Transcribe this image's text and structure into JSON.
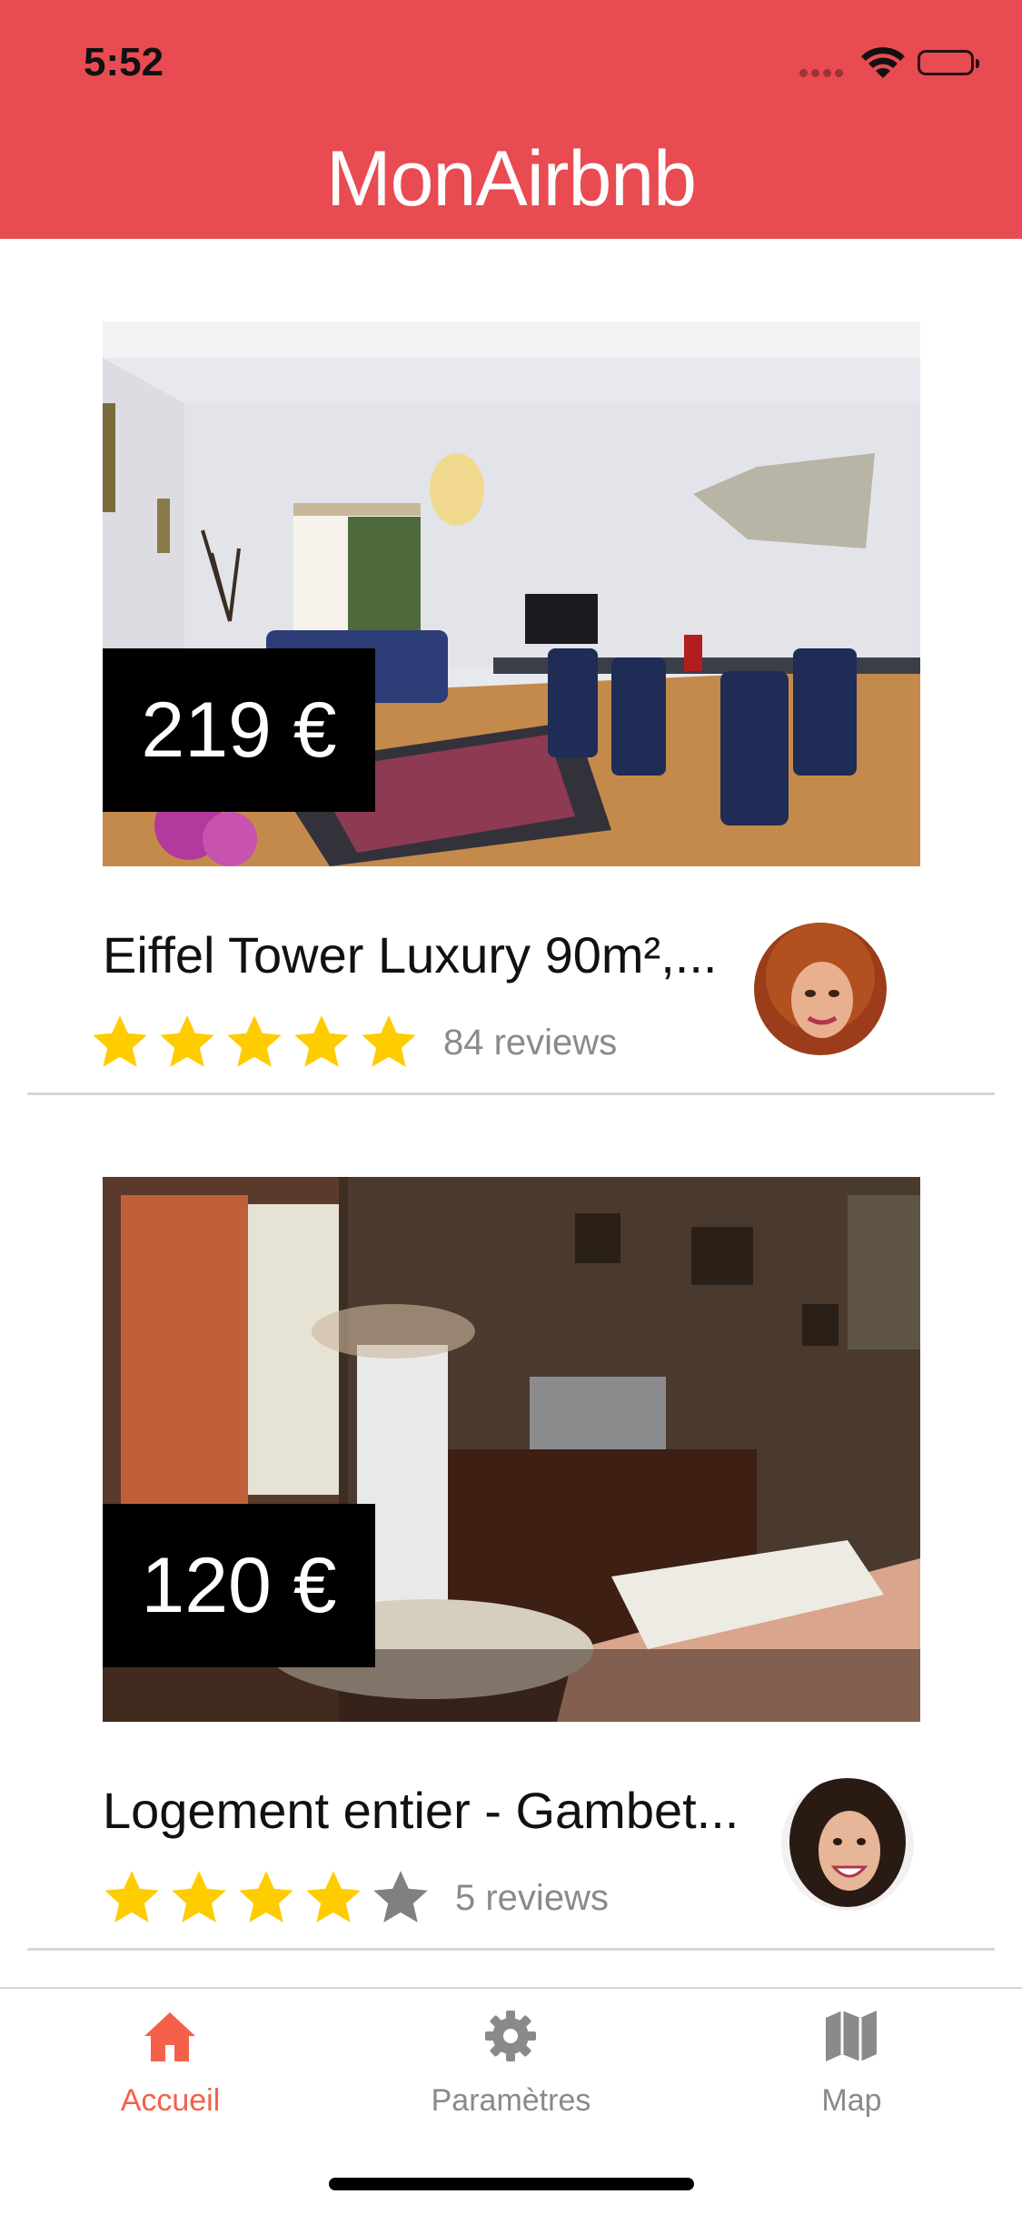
{
  "status_bar": {
    "time": "5:52"
  },
  "header": {
    "title": "MonAirbnb",
    "color": "#E94B52"
  },
  "listings": [
    {
      "price": "219 €",
      "title": "Eiffel Tower Luxury 90m²,...",
      "rating": 5,
      "max_rating": 5,
      "reviews": "84 reviews"
    },
    {
      "price": "120 €",
      "title": "Logement entier - Gambet...",
      "rating": 4,
      "max_rating": 5,
      "reviews": "5 reviews"
    }
  ],
  "tabbar": {
    "active_color": "#F4614A",
    "inactive_color": "#8a8a8a",
    "items": [
      {
        "label": "Accueil",
        "icon": "home-icon",
        "active": true
      },
      {
        "label": "Paramètres",
        "icon": "gear-icon",
        "active": false
      },
      {
        "label": "Map",
        "icon": "map-icon",
        "active": false
      }
    ]
  }
}
